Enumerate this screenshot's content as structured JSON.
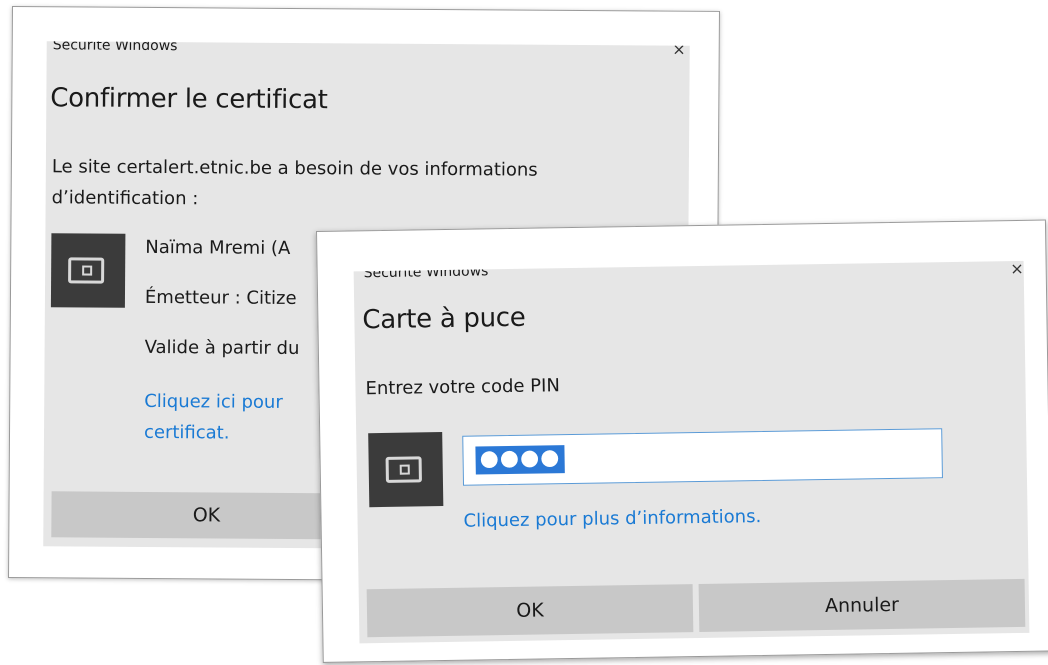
{
  "back_dialog": {
    "window_title": "Sécurité Windows",
    "close_glyph": "×",
    "title": "Confirmer le certificat",
    "description": "Le site certalert.etnic.be a besoin de vos informations d’identification :",
    "certificate": {
      "icon": "smart-card-icon",
      "name": "Naïma Mremi (A",
      "issuer": "Émetteur : Citize",
      "validity": "Valide à partir du",
      "link": "Cliquez ici pour  certificat."
    },
    "ok_label": "OK"
  },
  "front_dialog": {
    "window_title": "Sécurité Windows",
    "close_glyph": "×",
    "title": "Carte à puce",
    "prompt": "Entrez votre code PIN",
    "icon": "smart-card-icon",
    "pin_value": "●●●●",
    "info_link": "Cliquez pour plus d’informations.",
    "ok_label": "OK",
    "cancel_label": "Annuler"
  },
  "colors": {
    "dialog_bg": "#e6e6e6",
    "button_bg": "#c8c8c8",
    "link": "#1a7ad4",
    "selection": "#2b78d6",
    "icon_tile": "#3b3b3b"
  }
}
